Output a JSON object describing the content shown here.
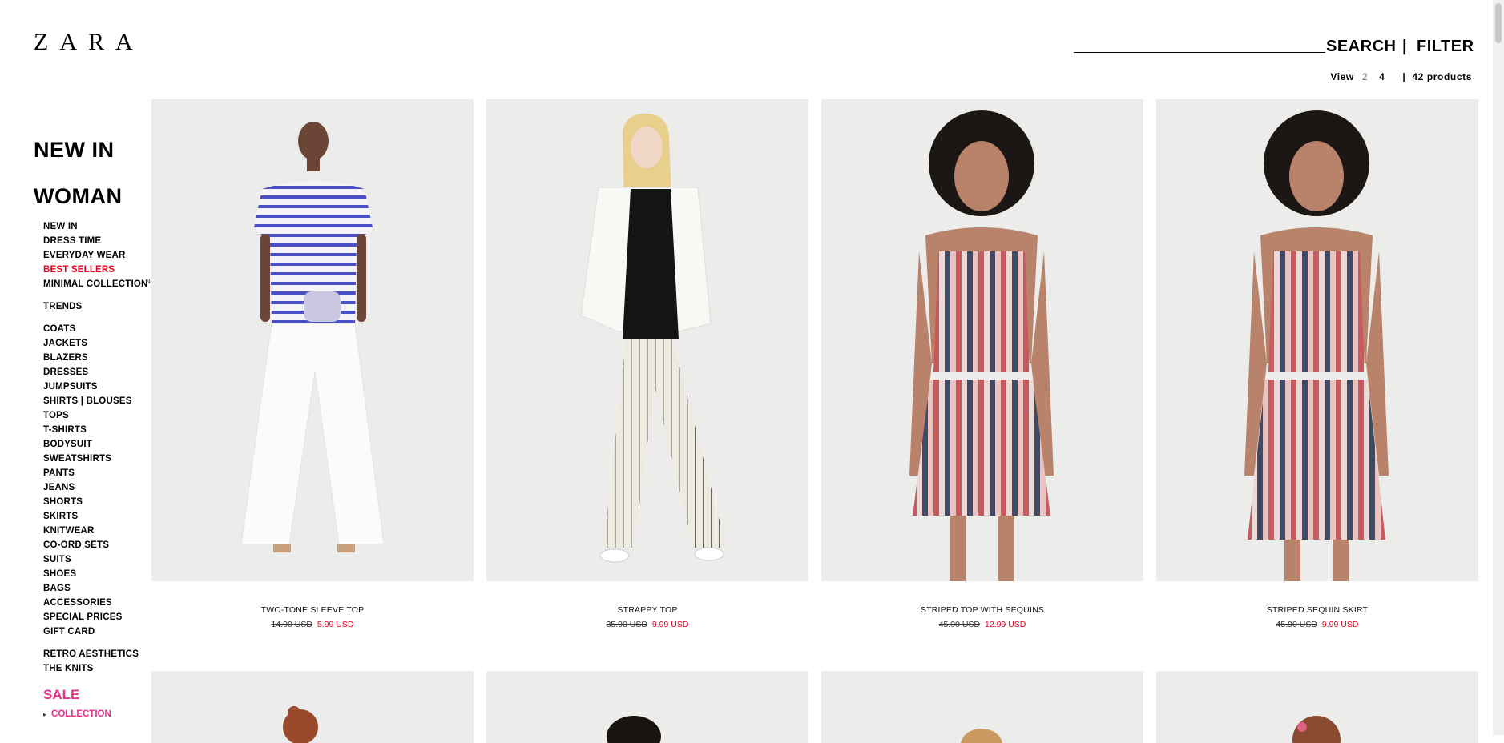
{
  "header": {
    "logo_text": "ZARA",
    "search_label": "SEARCH",
    "separator": "|",
    "filter_label": "FILTER"
  },
  "viewbar": {
    "view_label": "View",
    "option_2": "2",
    "option_4": "4",
    "separator": "|",
    "count": "42 products"
  },
  "sidebar": {
    "new_in": "NEW IN",
    "woman": "WOMAN",
    "items": [
      {
        "label": "NEW IN"
      },
      {
        "label": "DRESS TIME"
      },
      {
        "label": "EVERYDAY WEAR"
      },
      {
        "label": "BEST SELLERS"
      },
      {
        "label": "MINIMAL COLLECTION",
        "tag": "NEW"
      },
      {
        "label": "TRENDS"
      },
      {
        "label": "COATS"
      },
      {
        "label": "JACKETS"
      },
      {
        "label": "BLAZERS"
      },
      {
        "label": "DRESSES"
      },
      {
        "label": "JUMPSUITS"
      },
      {
        "label": "SHIRTS | BLOUSES"
      },
      {
        "label": "TOPS"
      },
      {
        "label": "T-SHIRTS"
      },
      {
        "label": "BODYSUIT"
      },
      {
        "label": "SWEATSHIRTS"
      },
      {
        "label": "PANTS"
      },
      {
        "label": "JEANS"
      },
      {
        "label": "SHORTS"
      },
      {
        "label": "SKIRTS"
      },
      {
        "label": "KNITWEAR"
      },
      {
        "label": "CO-ORD SETS"
      },
      {
        "label": "SUITS"
      },
      {
        "label": "SHOES"
      },
      {
        "label": "BAGS"
      },
      {
        "label": "ACCESSORIES"
      },
      {
        "label": "SPECIAL PRICES"
      },
      {
        "label": "GIFT CARD"
      },
      {
        "label": "RETRO AESTHETICS"
      },
      {
        "label": "THE KNITS"
      }
    ],
    "sale": "SALE",
    "sale_sub": "COLLECTION"
  },
  "products": [
    {
      "name": "TWO-TONE SLEEVE TOP",
      "old_price": "14.90 USD",
      "new_price": "5.99 USD"
    },
    {
      "name": "STRAPPY TOP",
      "old_price": "35.90 USD",
      "new_price": "9.99 USD"
    },
    {
      "name": "STRIPED TOP WITH SEQUINS",
      "old_price": "45.90 USD",
      "new_price": "12.99 USD"
    },
    {
      "name": "STRIPED SEQUIN SKIRT",
      "old_price": "45.90 USD",
      "new_price": "9.99 USD"
    }
  ],
  "colors": {
    "sale_red": "#e8001c",
    "sale_pink": "#e8308a",
    "photo_bg": "#ececeb"
  }
}
